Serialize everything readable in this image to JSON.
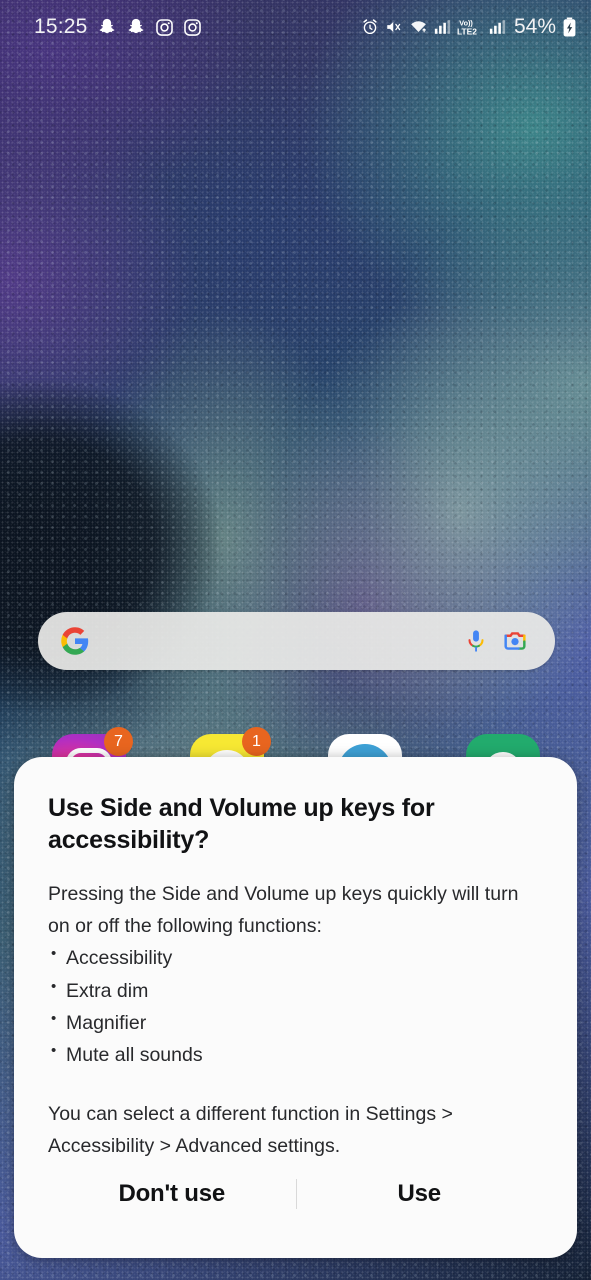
{
  "status_bar": {
    "clock": "15:25",
    "battery_percent": "54%",
    "left_icons": [
      {
        "name": "snapchat-icon"
      },
      {
        "name": "snapchat-icon"
      },
      {
        "name": "instagram-icon"
      },
      {
        "name": "instagram-icon"
      }
    ],
    "right_icons": [
      {
        "name": "alarm-icon"
      },
      {
        "name": "mute-icon"
      },
      {
        "name": "wifi-icon"
      },
      {
        "name": "signal-icon"
      },
      {
        "name": "volte-icon",
        "label_top": "Vo))",
        "label_bottom": "LTE2"
      },
      {
        "name": "signal-icon"
      },
      {
        "name": "battery-charging-icon"
      }
    ]
  },
  "home_screen": {
    "search_widget": {
      "placeholder": "",
      "value": "",
      "google_logo": "google-g-icon",
      "mic_icon": "microphone-icon",
      "lens_icon": "google-lens-icon"
    },
    "dock": [
      {
        "name": "instagram",
        "badge": "7"
      },
      {
        "name": "snapchat",
        "badge": "1"
      },
      {
        "name": "telegram",
        "badge": ""
      },
      {
        "name": "whatsapp",
        "badge": ""
      }
    ]
  },
  "dialog": {
    "title": "Use Side and Volume up keys for accessibility?",
    "intro": "Pressing the Side and Volume up keys quickly will turn on or off the following functions:",
    "functions": [
      "Accessibility",
      "Extra dim",
      "Magnifier",
      "Mute all sounds"
    ],
    "footnote": "You can select a different function in Settings > Accessibility > Advanced settings.",
    "buttons": {
      "negative": "Don't use",
      "positive": "Use"
    }
  },
  "colors": {
    "badge": "#e8651f",
    "dialog_bg": "#fbfbfb",
    "text_primary": "#111214",
    "background": "#0d1520"
  }
}
